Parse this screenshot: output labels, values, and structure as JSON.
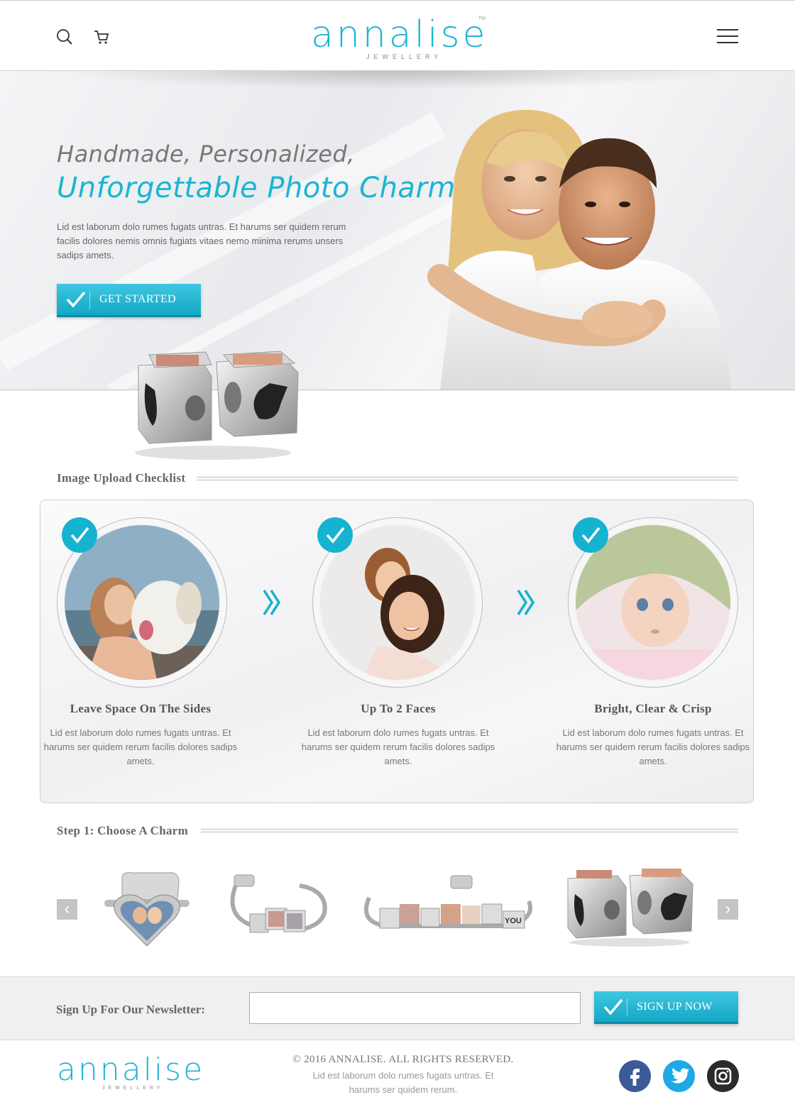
{
  "header": {
    "logo_text": "annalise",
    "logo_sub": "JEWELLERY",
    "logo_tm": "TM",
    "icons": [
      "search-icon",
      "cart-icon",
      "hamburger-menu-icon"
    ]
  },
  "hero": {
    "title_line1": "Handmade, Personalized,",
    "title_line2": "Unforgettable Photo Charms",
    "body": "Lid est laborum dolo rumes fugats untras. Et harums ser quidem rerum facilis dolores nemis omnis fugiats vitaes nemo minima rerums unsers sadips amets.",
    "cta_label": "GET STARTED"
  },
  "checklist": {
    "heading": "Image Upload Checklist",
    "items": [
      {
        "title": "Leave Space On The Sides",
        "body": "Lid est laborum dolo rumes fugats untras. Et harums ser quidem rerum facilis dolores sadips amets."
      },
      {
        "title": "Up To 2 Faces",
        "body": "Lid est laborum dolo rumes fugats untras. Et harums ser quidem rerum facilis dolores sadips amets."
      },
      {
        "title": "Bright, Clear & Crisp",
        "body": "Lid est laborum dolo rumes fugats untras. Et harums ser quidem rerum facilis dolores sadips amets."
      }
    ]
  },
  "charms": {
    "heading": "Step 1: Choose A Charm",
    "prev_glyph": "‹",
    "next_glyph": "›",
    "bracelet_text": "YOU"
  },
  "newsletter": {
    "label": "Sign Up For Our Newsletter:",
    "input_value": "",
    "button_label": "SIGN UP NOW"
  },
  "footer": {
    "logo_text": "annalise",
    "logo_sub": "JEWELLERY",
    "copyright": "© 2016 ANNALISE. ALL RIGHTS RESERVED.",
    "sub_text": "Lid est laborum dolo rumes fugats untras. Et harums ser quidem rerum.",
    "social": [
      "facebook-icon",
      "twitter-icon",
      "instagram-icon"
    ]
  },
  "colors": {
    "accent": "#1ab5d2",
    "facebook": "#3b5a98",
    "twitter": "#1ca9e6",
    "instagram": "#2b2b2b"
  }
}
